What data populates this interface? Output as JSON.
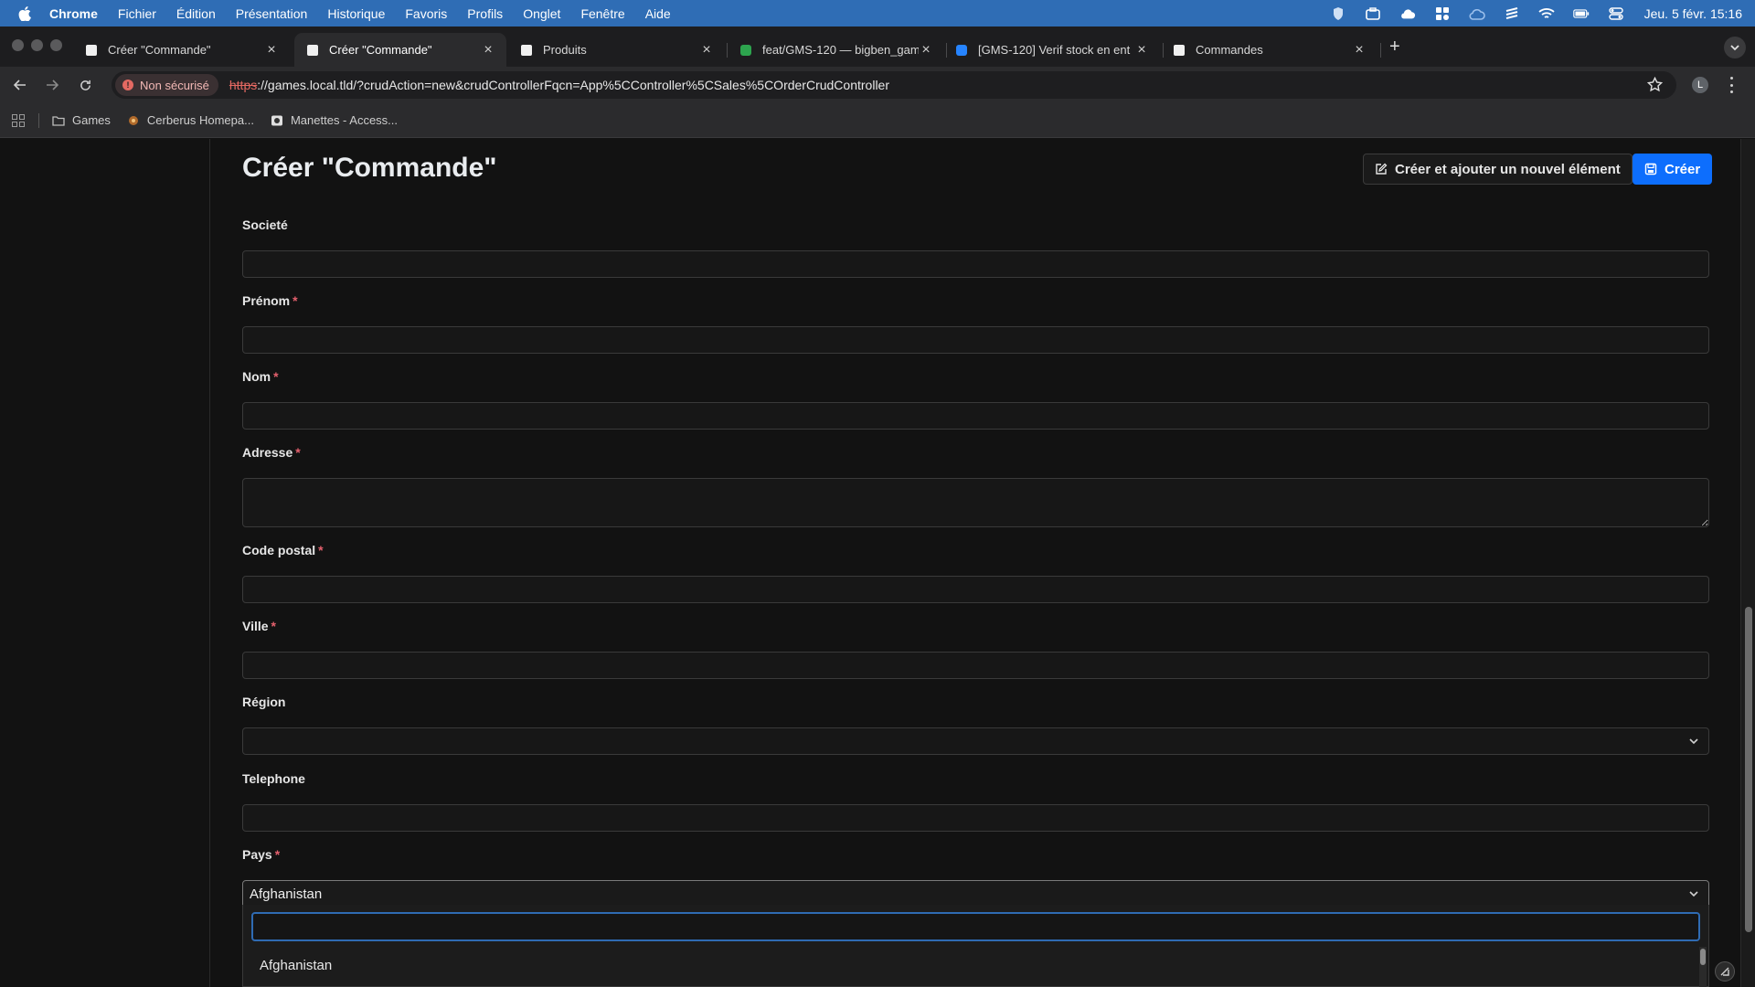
{
  "menubar": {
    "app": "Chrome",
    "items": [
      "Fichier",
      "Édition",
      "Présentation",
      "Historique",
      "Favoris",
      "Profils",
      "Onglet",
      "Fenêtre",
      "Aide"
    ],
    "clock": "Jeu. 5 févr.  15:16"
  },
  "tabs": [
    {
      "title": "Créer \"Commande\"",
      "close": "×"
    },
    {
      "title": "Créer \"Commande\"",
      "close": "×"
    },
    {
      "title": "Produits",
      "close": "×"
    },
    {
      "title": "feat/GMS-120 — bigben_gam",
      "close": "×"
    },
    {
      "title": "[GMS-120] Verif stock en ent",
      "close": "×"
    },
    {
      "title": "Commandes",
      "close": "×"
    }
  ],
  "toolbar": {
    "insecure_label": "Non sécurisé",
    "url_scheme": "https",
    "url_rest": "://games.local.tld/?crudAction=new&crudControllerFqcn=App%5CController%5CSales%5COrderCrudController",
    "profile_initial": "L"
  },
  "bookmarks": [
    {
      "label": "Games"
    },
    {
      "label": "Cerberus Homepa..."
    },
    {
      "label": "Manettes - Access..."
    }
  ],
  "page": {
    "title": "Créer \"Commande\"",
    "btn_add_another": "Créer et ajouter un nouvel élément",
    "btn_create": "Créer"
  },
  "form": {
    "societe": {
      "label": "Societé",
      "value": ""
    },
    "prenom": {
      "label": "Prénom",
      "value": ""
    },
    "nom": {
      "label": "Nom",
      "value": ""
    },
    "adresse": {
      "label": "Adresse",
      "value": ""
    },
    "code_postal": {
      "label": "Code postal",
      "value": ""
    },
    "ville": {
      "label": "Ville",
      "value": ""
    },
    "region": {
      "label": "Région",
      "value": ""
    },
    "telephone": {
      "label": "Telephone",
      "value": ""
    },
    "pays": {
      "label": "Pays",
      "value": "Afghanistan"
    },
    "required_mark": "*"
  },
  "dropdown": {
    "search_value": "",
    "options": [
      "Afghanistan"
    ]
  },
  "colors": {
    "accent": "#0d6efd",
    "required": "#e4606d",
    "menubar": "#2f6db5"
  }
}
